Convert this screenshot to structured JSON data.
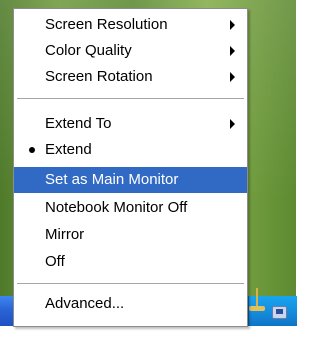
{
  "menu": {
    "items": [
      {
        "label": "Screen Resolution"
      },
      {
        "label": "Color Quality"
      },
      {
        "label": "Screen Rotation"
      },
      {
        "label": "Extend To"
      },
      {
        "label": "Extend"
      },
      {
        "label": "Set as Main Monitor"
      },
      {
        "label": "Notebook Monitor Off"
      },
      {
        "label": "Mirror"
      },
      {
        "label": "Off"
      },
      {
        "label": "Advanced..."
      }
    ]
  },
  "colors": {
    "highlight": "#316ac5",
    "taskbar": "#2a64d6",
    "tray": "#1489db"
  },
  "icons": {
    "submenu": "chevron-right-icon",
    "selected": "bullet-icon",
    "tray": "display-tray-icon"
  }
}
